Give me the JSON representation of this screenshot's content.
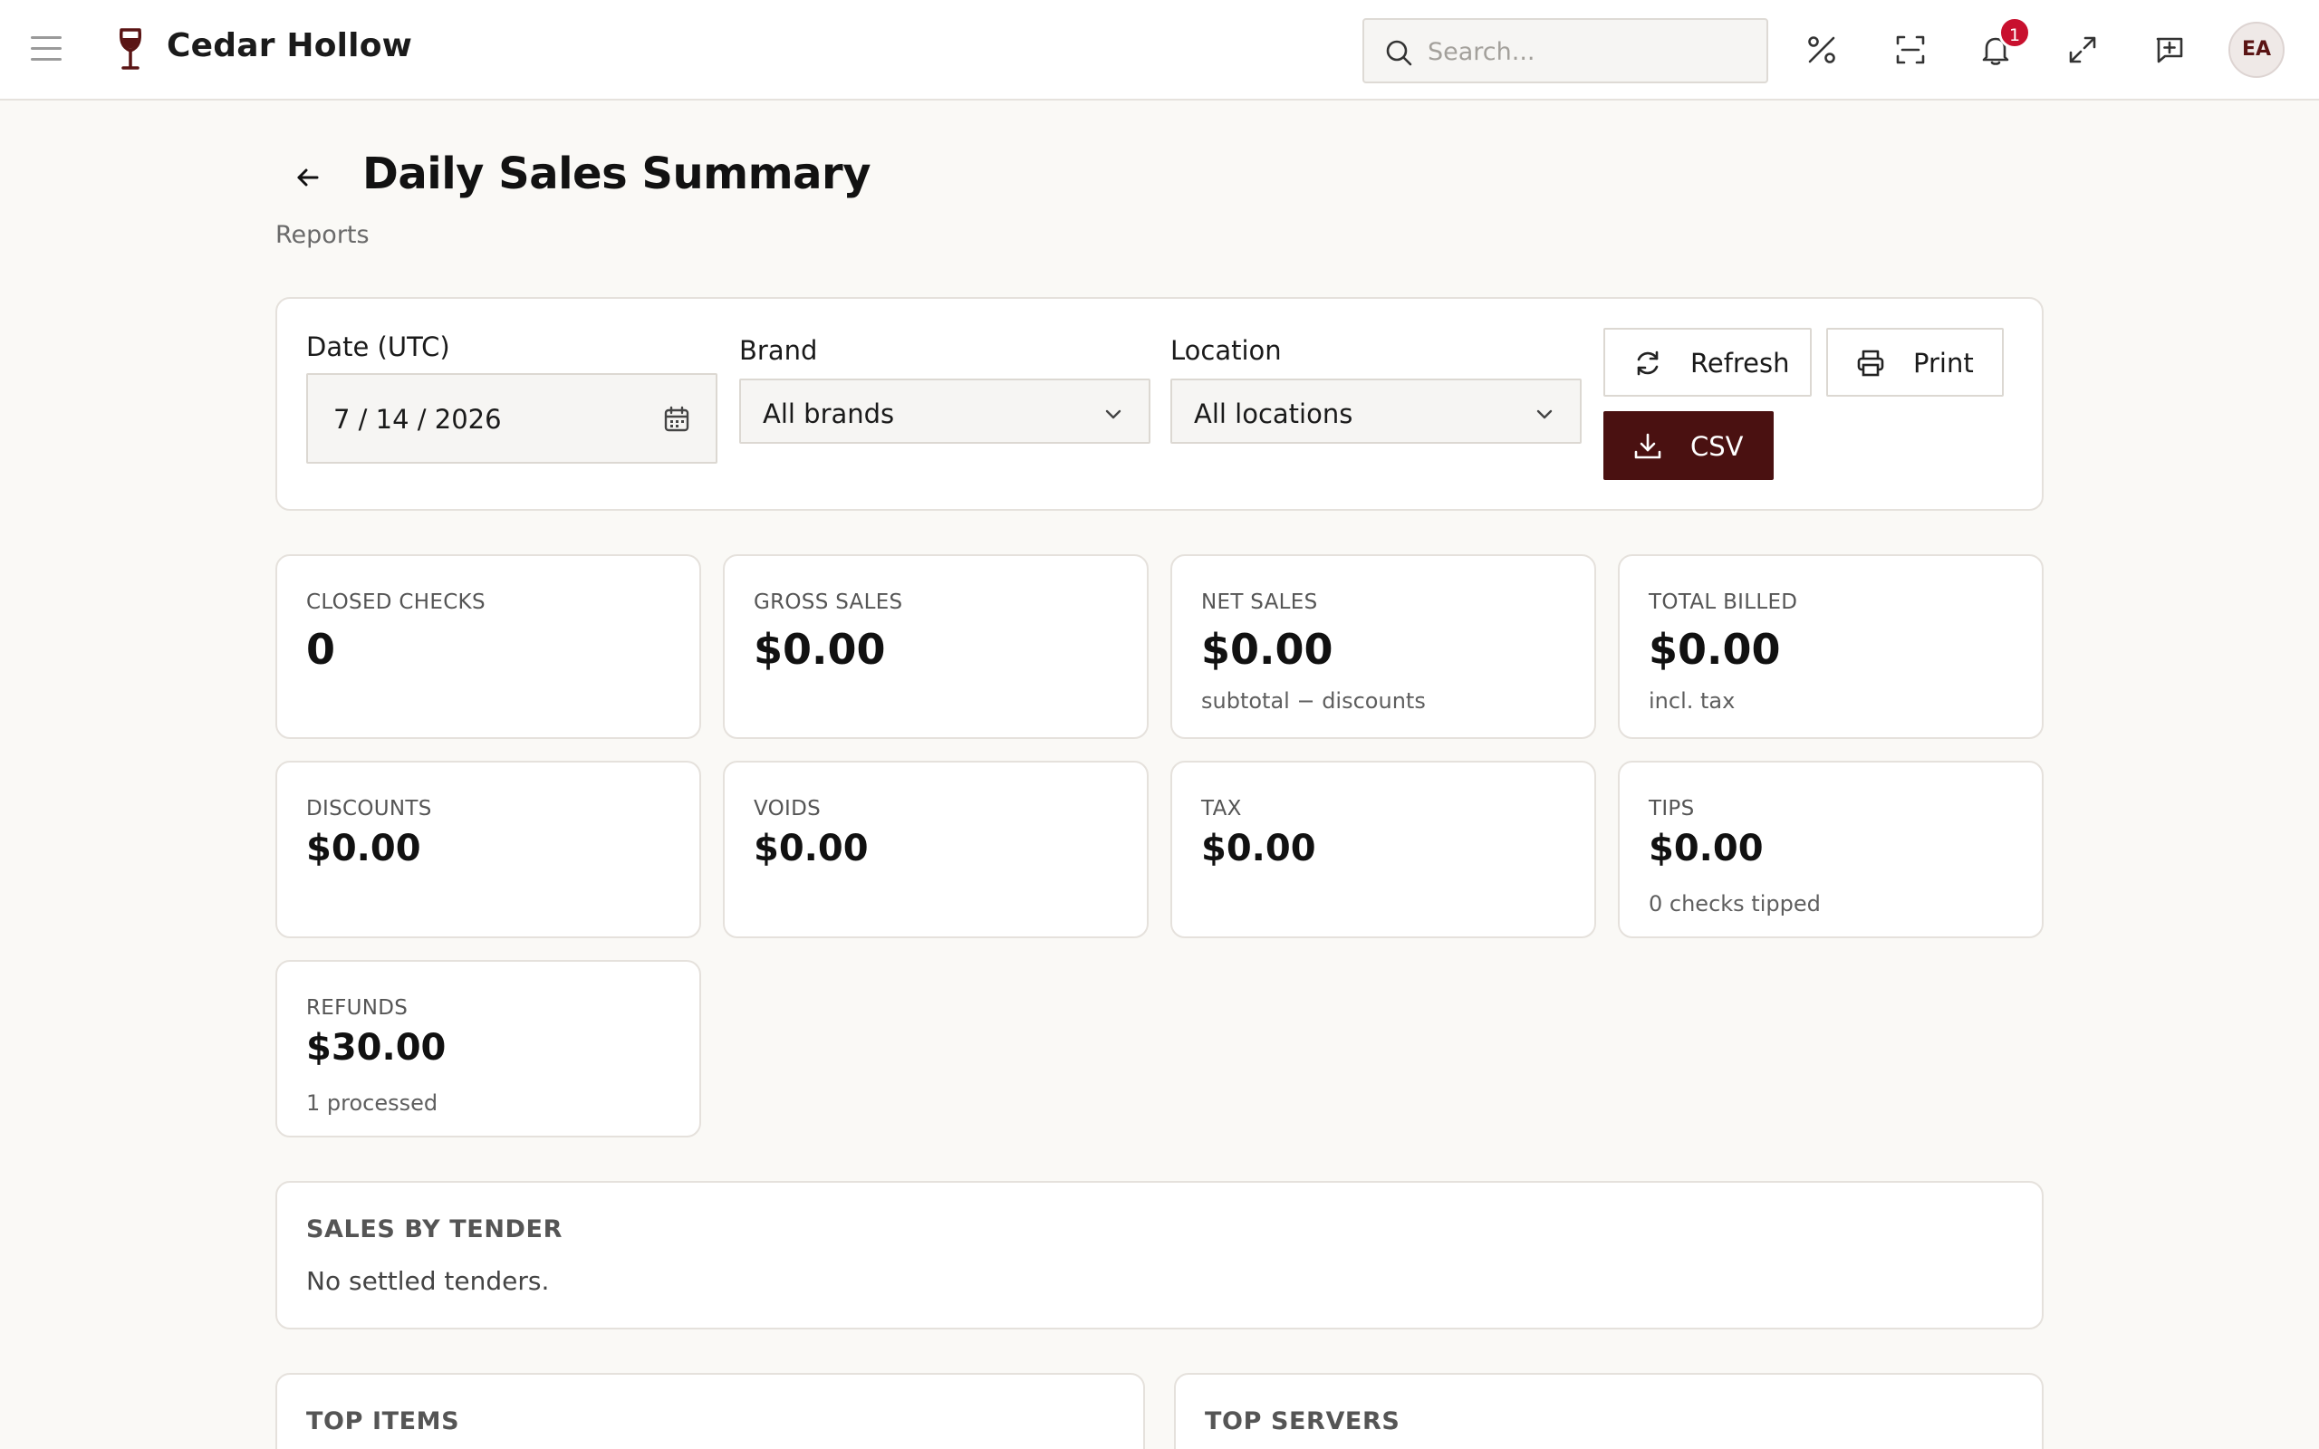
{
  "header": {
    "brand_name": "Cedar Hollow",
    "search_placeholder": "Search...",
    "notification_count": "1",
    "avatar_initials": "EA"
  },
  "page": {
    "title": "Daily Sales Summary",
    "subtitle": "Reports"
  },
  "filters": {
    "date_label": "Date (UTC)",
    "date_value": "7 / 14 / 2026",
    "brand_label": "Brand",
    "brand_value": "All brands",
    "location_label": "Location",
    "location_value": "All locations",
    "refresh_label": "Refresh",
    "print_label": "Print",
    "csv_label": "CSV"
  },
  "stats": {
    "closed_checks": {
      "label": "CLOSED CHECKS",
      "value": "0"
    },
    "gross_sales": {
      "label": "GROSS SALES",
      "value": "$0.00"
    },
    "net_sales": {
      "label": "NET SALES",
      "value": "$0.00",
      "note": "subtotal − discounts"
    },
    "total_billed": {
      "label": "TOTAL BILLED",
      "value": "$0.00",
      "note": "incl. tax"
    },
    "discounts": {
      "label": "DISCOUNTS",
      "value": "$0.00"
    },
    "voids": {
      "label": "VOIDS",
      "value": "$0.00"
    },
    "tax": {
      "label": "TAX",
      "value": "$0.00"
    },
    "tips": {
      "label": "TIPS",
      "value": "$0.00",
      "note": "0 checks tipped"
    },
    "refunds": {
      "label": "REFUNDS",
      "value": "$30.00",
      "note": "1 processed"
    }
  },
  "sections": {
    "sales_by_tender": {
      "title": "SALES BY TENDER",
      "empty": "No settled tenders."
    },
    "top_items": {
      "title": "TOP ITEMS"
    },
    "top_servers": {
      "title": "TOP SERVERS"
    }
  },
  "colors": {
    "accent": "#4a1111",
    "badge": "#c8102e",
    "background": "#faf9f6"
  }
}
